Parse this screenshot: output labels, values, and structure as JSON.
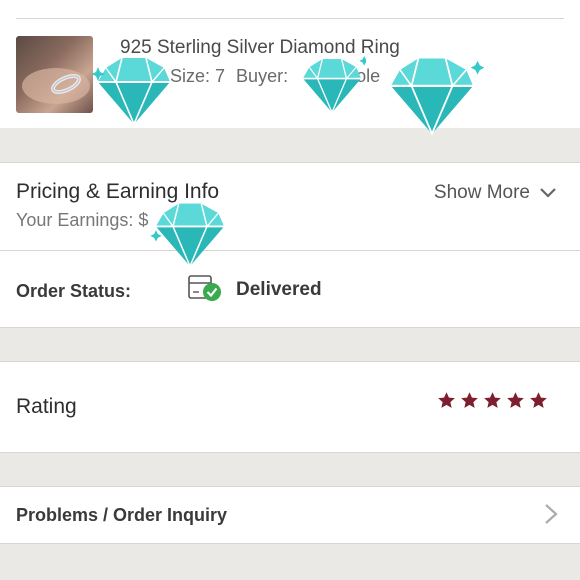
{
  "product": {
    "title": "925 Sterling Silver Diamond Ring",
    "size": "Size: 7",
    "buyer": "Buyer:",
    "buyer_name_fragment": "cole"
  },
  "pricing": {
    "title": "Pricing & Earning Info",
    "earnings_label": "Your Earnings: $",
    "show_more": "Show More",
    "order_status_label": "Order Status:",
    "order_status_value": "Delivered"
  },
  "rating": {
    "label": "Rating",
    "stars": 5,
    "star_color": "#7d1f2e"
  },
  "problems": {
    "label": "Problems / Order Inquiry"
  },
  "colors": {
    "diamond": "#35c9c9",
    "delivered_check": "#3aaa4f",
    "background": "#ebe9e5"
  },
  "icons": [
    "chevron-down-icon",
    "chevron-right-icon",
    "package-delivered-icon",
    "star-icon",
    "diamond-sticker-icon"
  ]
}
